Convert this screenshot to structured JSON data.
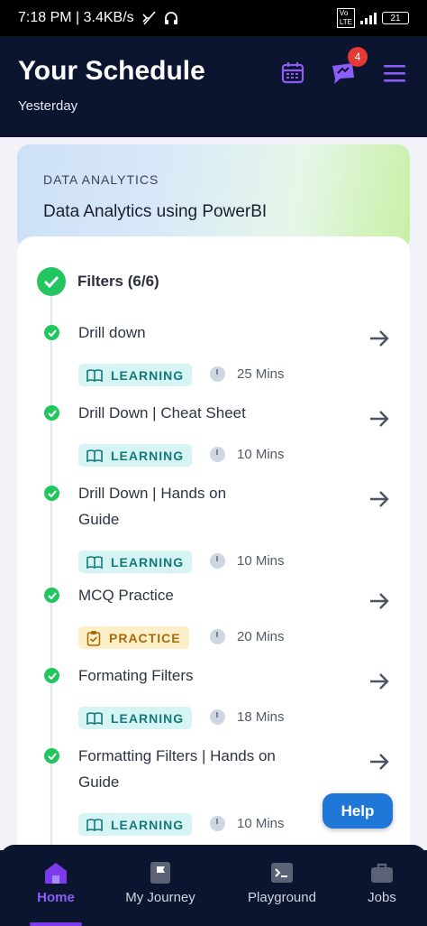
{
  "status_bar": {
    "time": "7:18 PM",
    "speed": "3.4KB/s",
    "battery": "21"
  },
  "header": {
    "title": "Your Schedule",
    "subtitle": "Yesterday",
    "notification_count": "4"
  },
  "course": {
    "category": "DATA ANALYTICS",
    "name": "Data Analytics using PowerBI"
  },
  "module": {
    "title": "Filters (6/6)"
  },
  "items": [
    {
      "title": "Drill down",
      "tag": "LEARNING",
      "duration": "25 Mins"
    },
    {
      "title": "Drill Down | Cheat Sheet",
      "tag": "LEARNING",
      "duration": "10 Mins"
    },
    {
      "title": "Drill Down | Hands on Guide",
      "tag": "LEARNING",
      "duration": "10 Mins"
    },
    {
      "title": "MCQ Practice",
      "tag": "PRACTICE",
      "duration": "20 Mins"
    },
    {
      "title": "Formating Filters",
      "tag": "LEARNING",
      "duration": "18 Mins"
    },
    {
      "title": "Formatting Filters | Hands on Guide",
      "tag": "LEARNING",
      "duration": "10 Mins"
    }
  ],
  "help": {
    "label": "Help"
  },
  "nav": [
    {
      "label": "Home",
      "icon": "home-icon"
    },
    {
      "label": "My Journey",
      "icon": "flag-icon"
    },
    {
      "label": "Playground",
      "icon": "terminal-icon"
    },
    {
      "label": "Jobs",
      "icon": "briefcase-icon"
    }
  ],
  "colors": {
    "accent": "#7c3aed",
    "success": "#22c55e",
    "help": "#1f77d8",
    "badge": "#e53935"
  }
}
